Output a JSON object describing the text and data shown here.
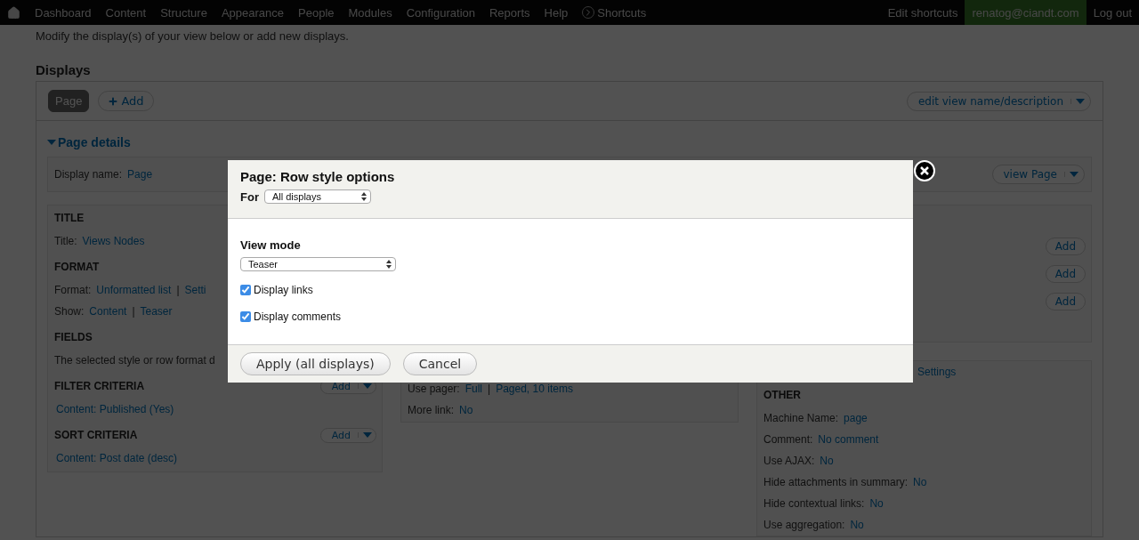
{
  "toolbar": {
    "menu": [
      "Dashboard",
      "Content",
      "Structure",
      "Appearance",
      "People",
      "Modules",
      "Configuration",
      "Reports",
      "Help"
    ],
    "shortcuts": "Shortcuts",
    "edit_shortcuts": "Edit shortcuts",
    "user": "renatog@ciandt.com",
    "logout": "Log out"
  },
  "intro": "Modify the display(s) of your view below or add new displays.",
  "displays": {
    "heading": "Displays",
    "tabs": [
      {
        "label": "Page",
        "selected": true
      }
    ],
    "add_button": "Add",
    "edit_button": "edit view name/description"
  },
  "details": {
    "toggle": "Page details",
    "expanded": true,
    "display_name_label": "Display name:",
    "display_name": "Page",
    "view_button": "view Page"
  },
  "left_sections": [
    {
      "title": "TITLE",
      "rows": [
        {
          "label": "Title:",
          "links": [
            "Views Nodes"
          ]
        }
      ]
    },
    {
      "title": "FORMAT",
      "rows": [
        {
          "label": "Format:",
          "links": [
            "Unformatted list",
            "Setti"
          ],
          "separator": "|"
        },
        {
          "label": "Show:",
          "links": [
            "Content",
            "Teaser"
          ],
          "separator": "|"
        }
      ]
    },
    {
      "title": "FIELDS",
      "rows": [
        {
          "text": "The selected style or row format d"
        }
      ]
    },
    {
      "title": "FILTER CRITERIA",
      "add": "Add",
      "rows": [
        {
          "links": [
            "Content: Published (Yes)"
          ]
        }
      ]
    },
    {
      "title": "SORT CRITERIA",
      "add": "Add",
      "rows": [
        {
          "links": [
            "Content: Post date (desc)"
          ]
        }
      ]
    }
  ],
  "middle_rows": [
    {
      "label": "Use pager:",
      "links": [
        "Full",
        "Paged, 10 items"
      ],
      "separator": "|"
    },
    {
      "label": "More link:",
      "links": [
        "No"
      ]
    }
  ],
  "right_add_buttons": [
    "Add",
    "Add",
    "Add"
  ],
  "right_settings_link": "Settings",
  "other": {
    "title": "OTHER",
    "rows": [
      {
        "label": "Machine Name:",
        "links": [
          "page"
        ]
      },
      {
        "label": "Comment:",
        "links": [
          "No comment"
        ]
      },
      {
        "label": "Use AJAX:",
        "links": [
          "No"
        ]
      },
      {
        "label": "Hide attachments in summary:",
        "links": [
          "No"
        ]
      },
      {
        "label": "Hide contextual links:",
        "links": [
          "No"
        ]
      },
      {
        "label": "Use aggregation:",
        "links": [
          "No"
        ]
      }
    ]
  },
  "modal": {
    "title": "Page: Row style options",
    "for_label": "For",
    "for_value": "All displays",
    "view_mode_label": "View mode",
    "view_mode_value": "Teaser",
    "checkboxes": [
      {
        "label": "Display links",
        "checked": true
      },
      {
        "label": "Display comments",
        "checked": true
      }
    ],
    "apply": "Apply (all displays)",
    "cancel": "Cancel"
  }
}
